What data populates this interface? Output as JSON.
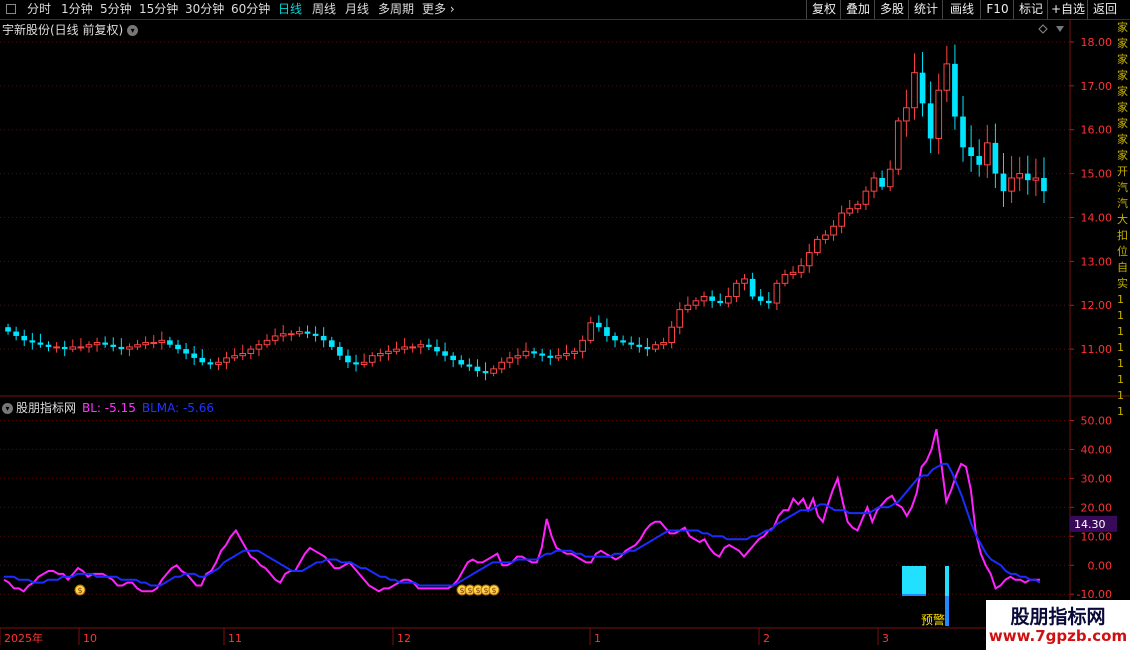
{
  "toolbar": {
    "periods": [
      {
        "label": "分时",
        "active": false
      },
      {
        "label": "1分钟",
        "active": false
      },
      {
        "label": "5分钟",
        "active": false
      },
      {
        "label": "15分钟",
        "active": false
      },
      {
        "label": "30分钟",
        "active": false
      },
      {
        "label": "60分钟",
        "active": false
      },
      {
        "label": "日线",
        "active": true
      },
      {
        "label": "周线",
        "active": false
      },
      {
        "label": "月线",
        "active": false
      },
      {
        "label": "多周期",
        "active": false
      },
      {
        "label": "更多 ›",
        "active": false
      }
    ],
    "right_buttons": [
      "复权",
      "叠加",
      "多股",
      "统计",
      "画线",
      "F10",
      "标记",
      "+自选",
      "返回"
    ]
  },
  "main_chart": {
    "title": "宇新股份(日线 前复权)",
    "price_ticks": [
      "18.00",
      "17.00",
      "16.00",
      "15.00",
      "14.00",
      "13.00",
      "12.00",
      "11.00"
    ],
    "ylim": [
      10.0,
      18.5
    ],
    "up_color": "#ff4444",
    "down_color": "#00e5ff"
  },
  "indicator": {
    "name": "股朋指标网",
    "bl_label": "BL: -5.15",
    "blma_label": "BLMA: -5.66",
    "ticks": [
      "50.00",
      "40.00",
      "30.00",
      "20.00",
      "10.00",
      "0.00",
      "-10.00"
    ],
    "cursor_value": "14.30",
    "warning_label": "预警",
    "bl_color": "#ff22ff",
    "blma_color": "#1c2cff",
    "ylim": [
      -12,
      55
    ]
  },
  "date_axis": [
    "2025年",
    "10",
    "11",
    "12",
    "1",
    "2",
    "3"
  ],
  "watermark": {
    "line1": "股朋指标网",
    "line2": "www.7gpzb.com"
  },
  "chart_data": {
    "type": "line",
    "title": "",
    "series": [
      {
        "name": "BL",
        "values": [
          -5,
          -6,
          -8,
          -8,
          -9,
          -7,
          -6,
          -4,
          -3,
          -2,
          -2,
          -3,
          -3,
          -5,
          -3,
          -1,
          -2,
          -4,
          -3,
          -3,
          -3,
          -4,
          -5,
          -7,
          -7,
          -6,
          -6,
          -8,
          -9,
          -9,
          -9,
          -8,
          -5,
          -3,
          -1,
          0,
          -2,
          -3,
          -5,
          -7,
          -7,
          -3,
          -2,
          1,
          5,
          7,
          10,
          12,
          9,
          6,
          3,
          2,
          0,
          -1,
          -3,
          -5,
          -6,
          -3,
          -2,
          -2,
          1,
          4,
          6,
          5,
          4,
          3,
          1,
          -1,
          -1,
          0,
          1,
          -1,
          -3,
          -5,
          -7,
          -8,
          -9,
          -8,
          -8,
          -7,
          -6,
          -5,
          -5,
          -6,
          -8,
          -8,
          -8,
          -8,
          -8,
          -8,
          -8,
          -7,
          -5,
          -2,
          1,
          2,
          1,
          1,
          2,
          3,
          4,
          0,
          0,
          1,
          3,
          3,
          2,
          1,
          1,
          6,
          16,
          10,
          6,
          5,
          4,
          4,
          3,
          2,
          1,
          1,
          4,
          5,
          4,
          3,
          2,
          3,
          5,
          6,
          7,
          9,
          12,
          14,
          15,
          15,
          13,
          11,
          11,
          12,
          13,
          10,
          9,
          8,
          9,
          6,
          4,
          3,
          6,
          7,
          6,
          5,
          3,
          5,
          7,
          9,
          10,
          12,
          13,
          17,
          19,
          19,
          23,
          21,
          23,
          19,
          23,
          17,
          15,
          21,
          26,
          30,
          22,
          15,
          13,
          12,
          16,
          20,
          15,
          19,
          21,
          23,
          24,
          21,
          20,
          17,
          20,
          25,
          34,
          36,
          40,
          47,
          35,
          22,
          26,
          31,
          35,
          34,
          26,
          11,
          4,
          0,
          -3,
          -8,
          -7,
          -5,
          -4,
          -5,
          -5,
          -6,
          -5,
          -5,
          -5
        ]
      },
      {
        "name": "BLMA",
        "values": [
          -4,
          -4,
          -4,
          -5,
          -5,
          -5,
          -6,
          -6,
          -6,
          -5,
          -5,
          -5,
          -4,
          -4,
          -4,
          -3,
          -3,
          -3,
          -3,
          -4,
          -4,
          -4,
          -4,
          -4,
          -5,
          -5,
          -5,
          -5,
          -6,
          -6,
          -7,
          -7,
          -7,
          -6,
          -5,
          -4,
          -4,
          -3,
          -3,
          -3,
          -4,
          -4,
          -3,
          -2,
          -1,
          1,
          2,
          3,
          4,
          5,
          5,
          5,
          5,
          4,
          3,
          2,
          1,
          0,
          -1,
          -2,
          -2,
          -2,
          -1,
          0,
          1,
          1,
          2,
          2,
          2,
          1,
          1,
          1,
          0,
          -1,
          -1,
          -2,
          -3,
          -4,
          -4,
          -5,
          -5,
          -6,
          -6,
          -6,
          -6,
          -7,
          -7,
          -7,
          -7,
          -7,
          -7,
          -7,
          -7,
          -6,
          -5,
          -4,
          -3,
          -2,
          -1,
          0,
          1,
          1,
          1,
          1,
          1,
          2,
          2,
          2,
          2,
          2,
          3,
          4,
          4,
          5,
          5,
          5,
          5,
          4,
          4,
          3,
          3,
          3,
          3,
          3,
          3,
          4,
          4,
          4,
          5,
          5,
          6,
          7,
          8,
          9,
          10,
          11,
          12,
          12,
          12,
          12,
          12,
          12,
          12,
          11,
          11,
          10,
          10,
          10,
          9,
          9,
          9,
          9,
          9,
          10,
          10,
          11,
          12,
          12,
          14,
          15,
          16,
          17,
          18,
          19,
          19,
          19,
          20,
          21,
          21,
          20,
          19,
          19,
          19,
          18,
          18,
          18,
          18,
          18,
          19,
          20,
          20,
          20,
          21,
          22,
          24,
          26,
          28,
          30,
          31,
          31,
          33,
          34,
          35,
          35,
          32,
          28,
          24,
          19,
          14,
          10,
          7,
          4,
          2,
          1,
          0,
          -2,
          -3,
          -3,
          -4,
          -4,
          -5,
          -5,
          -6
        ]
      }
    ],
    "ylim": [
      -12,
      55
    ]
  },
  "right_strip": [
    "家",
    "家",
    "家",
    "家",
    "家",
    "家",
    "家",
    "家",
    "家",
    "开",
    "汽",
    "汽",
    "大",
    "扣",
    "位",
    "自",
    "实",
    "1",
    "1",
    "1",
    "1",
    "1",
    "1",
    "1",
    "1"
  ]
}
